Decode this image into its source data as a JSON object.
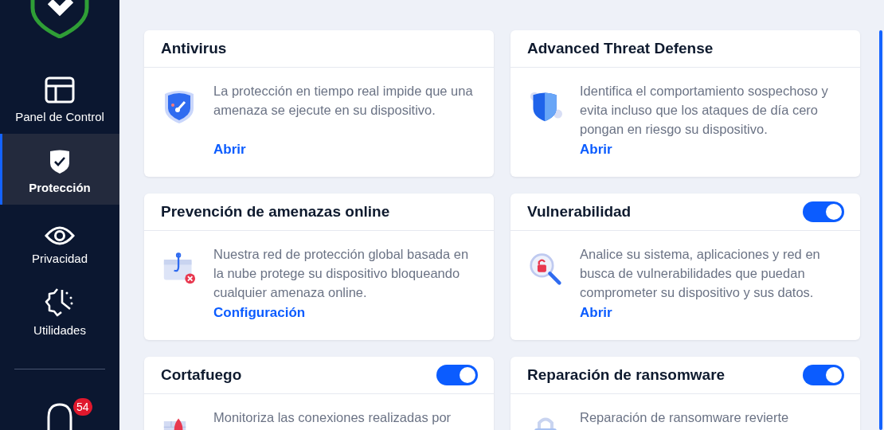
{
  "sidebar": {
    "items": [
      {
        "label": "Panel de Control",
        "selected": false
      },
      {
        "label": "Protección",
        "selected": true
      },
      {
        "label": "Privacidad",
        "selected": false
      },
      {
        "label": "Utilidades",
        "selected": false
      }
    ],
    "notifications": {
      "badge": "54"
    }
  },
  "cards": [
    {
      "title": "Antivirus",
      "description": "La protección en tiempo real impide que una amenaza se ejecute en su dispositivo.",
      "link": "Abrir"
    },
    {
      "title": "Advanced Threat Defense",
      "description": "Identifica el comportamiento sospechoso y evita incluso que los ataques de día cero pongan en riesgo su dispositivo.",
      "link": "Abrir"
    },
    {
      "title": "Prevención de amenazas online",
      "description": "Nuestra red de protección global basada en la nube protege su dispositivo bloqueando cualquier amenaza online.",
      "link": "Configuración"
    },
    {
      "title": "Vulnerabilidad",
      "on": true,
      "description": "Analice su sistema, aplicaciones y red en busca de vulnerabilidades que puedan comprometer su dispositivo y sus datos.",
      "link": "Abrir"
    },
    {
      "title": "Cortafuego",
      "on": true,
      "description": "Monitoriza las conexiones realizadas por"
    },
    {
      "title": "Reparación de ransomware",
      "on": true,
      "description": "Reparación de ransomware revierte"
    }
  ]
}
